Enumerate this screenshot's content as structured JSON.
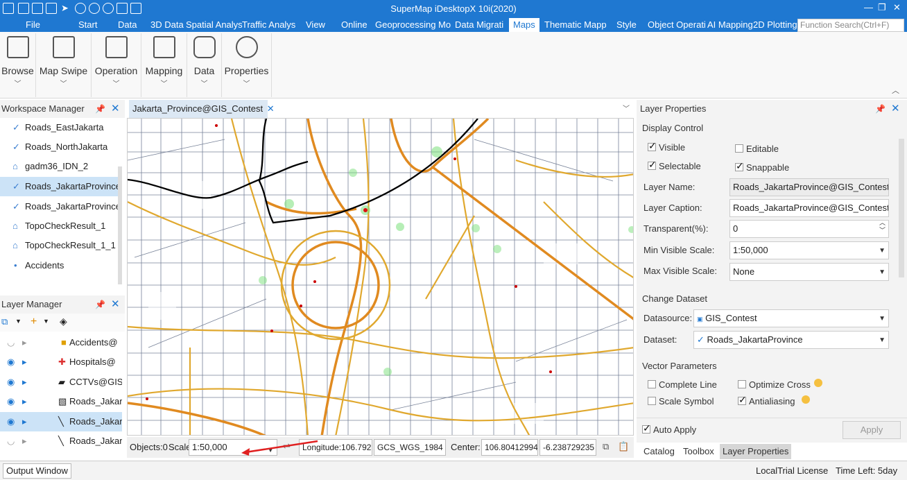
{
  "app": {
    "title": "SuperMap iDesktopX 10i(2020)"
  },
  "menu": {
    "items": [
      "File",
      "Start",
      "Data",
      "3D Data",
      "Spatial Analys",
      "Traffic Analys",
      "View",
      "Online",
      "Geoprocessing Mo",
      "Data Migrati",
      "Maps",
      "Thematic Mapp",
      "Style",
      "Object Operati",
      "AI Mapping",
      "2D Plotting"
    ],
    "active": "Maps"
  },
  "search": {
    "placeholder": "Function Search(Ctrl+F)"
  },
  "ribbon": {
    "groups": [
      "Browse",
      "Map Swipe",
      "Operation",
      "Mapping",
      "Data",
      "Properties"
    ]
  },
  "workspace": {
    "title": "Workspace Manager",
    "items": [
      "Roads_EastJakarta",
      "Roads_NorthJakarta",
      "gadm36_IDN_2",
      "Roads_JakartaProvince",
      "Roads_JakartaProvince_",
      "TopoCheckResult_1",
      "TopoCheckResult_1_1",
      "Accidents"
    ],
    "selected": 3
  },
  "layers": {
    "title": "Layer Manager",
    "items": [
      "Accidents@",
      "Hospitals@",
      "CCTVs@GIS",
      "Roads_Jakar",
      "Roads_Jakar",
      "Roads_Jakar"
    ],
    "selected": 4
  },
  "map": {
    "tab": "Jakarta_Province@GIS_Contest"
  },
  "status": {
    "objects": "Objects:0",
    "scale_label": "Scale:",
    "scale_value": "1:50,000",
    "longitude": "Longitude:106.792",
    "crs": "GCS_WGS_1984",
    "center_label": "Center:",
    "center_x": "106.80412994",
    "center_y": "-6.238729235"
  },
  "props": {
    "title": "Layer Properties",
    "display_control": "Display Control",
    "visible": "Visible",
    "editable": "Editable",
    "selectable": "Selectable",
    "snappable": "Snappable",
    "layer_name_label": "Layer Name:",
    "layer_name": "Roads_JakartaProvince@GIS_Contest",
    "layer_caption_label": "Layer Caption:",
    "layer_caption": "Roads_JakartaProvince@GIS_Contest",
    "transparent_label": "Transparent(%):",
    "transparent": "0",
    "min_scale_label": "Min Visible Scale:",
    "min_scale": "1:50,000",
    "max_scale_label": "Max Visible Scale:",
    "max_scale": "None",
    "change_dataset": "Change Dataset",
    "datasource_label": "Datasource:",
    "datasource": "GIS_Contest",
    "dataset_label": "Dataset:",
    "dataset": "Roads_JakartaProvince",
    "vector_params": "Vector Parameters",
    "complete_line": "Complete Line",
    "optimize_cross": "Optimize Cross",
    "scale_symbol": "Scale Symbol",
    "antialiasing": "Antialiasing",
    "auto_apply": "Auto Apply",
    "apply": "Apply"
  },
  "bottom_tabs": [
    "Catalog",
    "Toolbox",
    "Layer Properties"
  ],
  "footer": {
    "output": "Output Window",
    "license": "LocalTrial License",
    "time_left": "Time Left: 5day"
  }
}
